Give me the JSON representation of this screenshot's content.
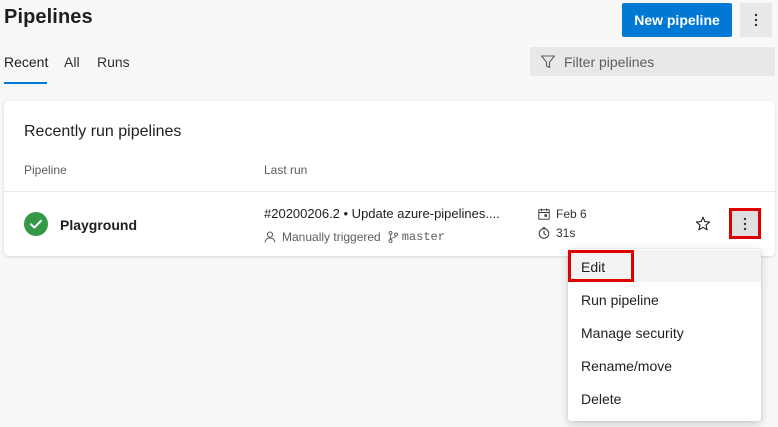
{
  "header": {
    "title": "Pipelines",
    "new_button": "New pipeline",
    "more_icon": "more-vertical-icon"
  },
  "tabs": [
    {
      "label": "Recent",
      "selected": true
    },
    {
      "label": "All",
      "selected": false
    },
    {
      "label": "Runs",
      "selected": false
    }
  ],
  "filter": {
    "placeholder": "Filter pipelines",
    "icon": "filter-icon"
  },
  "card": {
    "title": "Recently run pipelines",
    "columns": [
      "Pipeline",
      "Last run"
    ],
    "rows": [
      {
        "status": "succeeded",
        "status_icon": "check-circle-icon",
        "name": "Playground",
        "run_title": "#20200206.2 • Update azure-pipelines....",
        "trigger": "Manually triggered",
        "branch": "master",
        "date": "Feb 6",
        "duration": "31s"
      }
    ]
  },
  "context_menu": {
    "items": [
      "Edit",
      "Run pipeline",
      "Manage security",
      "Rename/move",
      "Delete"
    ],
    "highlighted": "Edit"
  },
  "colors": {
    "accent": "#0078d4",
    "success": "#339947",
    "highlight_box": "#e00000"
  }
}
